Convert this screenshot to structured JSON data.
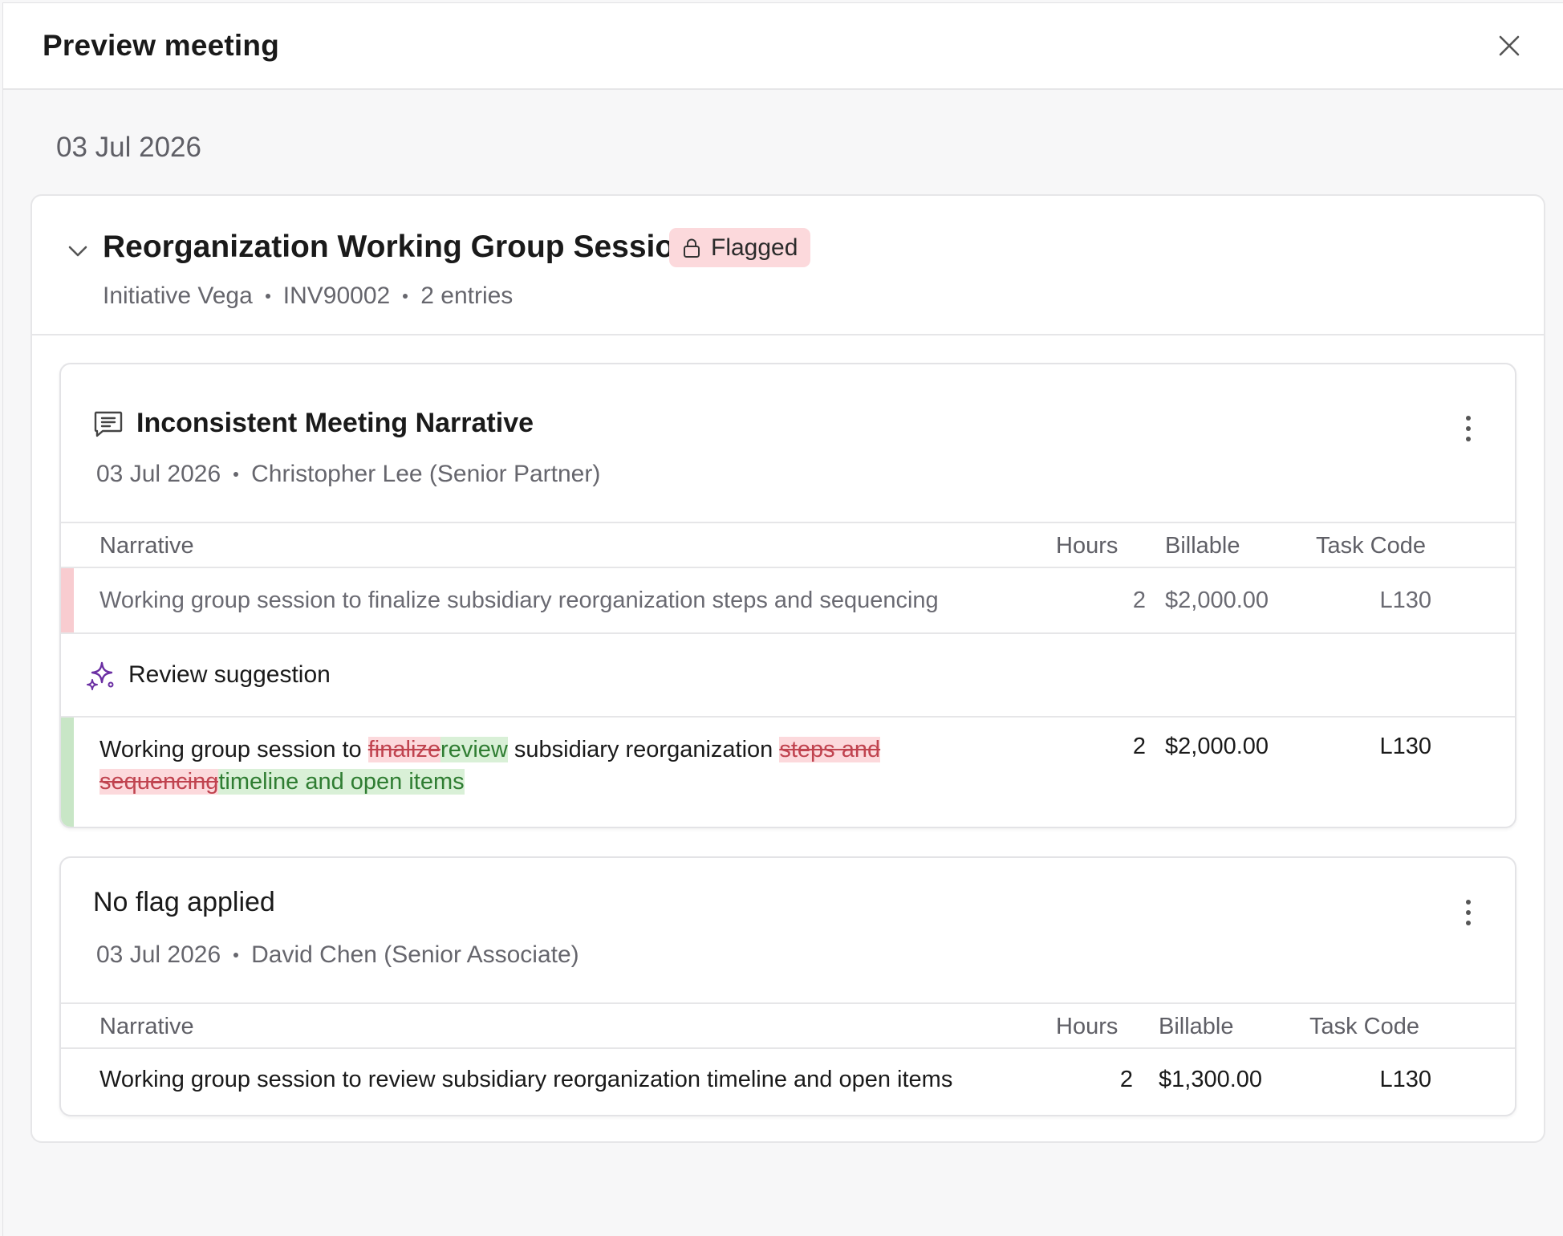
{
  "modal": {
    "title": "Preview meeting"
  },
  "date_heading": "03 Jul 2026",
  "meeting": {
    "title": "Reorganization Working Group Session",
    "badge": "Flagged",
    "meta": [
      "Initiative Vega",
      "INV90002",
      "2 entries"
    ]
  },
  "columns": {
    "narrative": "Narrative",
    "hours": "Hours",
    "billable": "Billable",
    "task_code": "Task Code"
  },
  "entries": [
    {
      "title": "Inconsistent Meeting Narrative",
      "date": "03 Jul 2026",
      "person": "Christopher Lee (Senior Partner)",
      "row": {
        "narrative": "Working group session to finalize subsidiary reorganization steps and sequencing",
        "hours": "2",
        "billable": "$2,000.00",
        "task_code": "L130"
      },
      "suggestion": {
        "label": "Review suggestion",
        "parts": [
          "Working group session to ",
          "finalize",
          "review",
          " subsidiary reorganization ",
          "steps and sequencing",
          "timeline and open items"
        ],
        "hours": "2",
        "billable": "$2,000.00",
        "task_code": "L130"
      }
    },
    {
      "title": "No flag applied",
      "date": "03 Jul 2026",
      "person": "David Chen (Senior Associate)",
      "row": {
        "narrative": "Working group session to review subsidiary reorganization timeline and open items",
        "hours": "2",
        "billable": "$1,300.00",
        "task_code": "L130"
      }
    }
  ],
  "colors": {
    "flag_bg": "#fcd9dc",
    "flag_bar": "#f8ccd0",
    "suggest_bar": "#c8e6c6",
    "insert_bg": "#d9f0d7",
    "delete_text": "#c0434f",
    "accent_purple": "#6b2fa3"
  }
}
